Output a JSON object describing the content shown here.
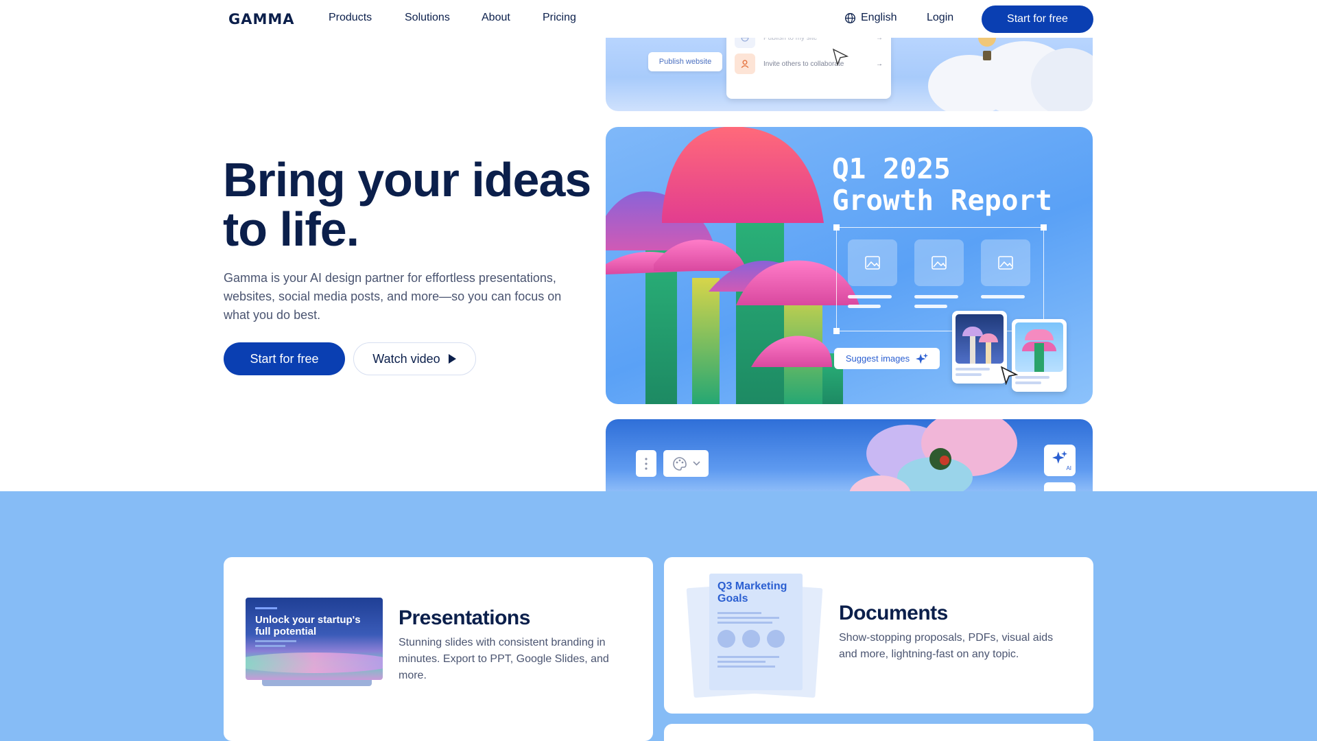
{
  "nav": {
    "logo": "GAMMA",
    "links": [
      "Products",
      "Solutions",
      "About",
      "Pricing"
    ],
    "language": "English",
    "login": "Login",
    "cta": "Start for free"
  },
  "hero": {
    "title": "Bring your ideas to life.",
    "subtitle": "Gamma is your AI design partner for effortless presentations, websites, social media posts, and more—so you can focus on what you do best.",
    "primary_button": "Start for free",
    "secondary_button": "Watch video"
  },
  "media_top": {
    "publish_button": "Publish website",
    "menu_items": [
      "Publish to my site",
      "Invite others to collaborate"
    ]
  },
  "media_main": {
    "report_title_line1": "Q1 2025",
    "report_title_line2": "Growth Report",
    "suggest_button": "Suggest images"
  },
  "media_bottom": {
    "ai_label": "AI"
  },
  "features": [
    {
      "title": "Presentations",
      "text": "Stunning slides with consistent branding in minutes. Export to PPT, Google Slides, and more.",
      "thumb_title": "Unlock your startup's full potential"
    },
    {
      "title": "Documents",
      "text": "Show-stopping proposals, PDFs, visual aids and more, lightning-fast on any topic.",
      "thumb_title": "Q3 Marketing Goals"
    }
  ],
  "colors": {
    "brand": "#0a3fb2",
    "navy": "#0b1f4b",
    "section_blue": "#86bcf6"
  }
}
